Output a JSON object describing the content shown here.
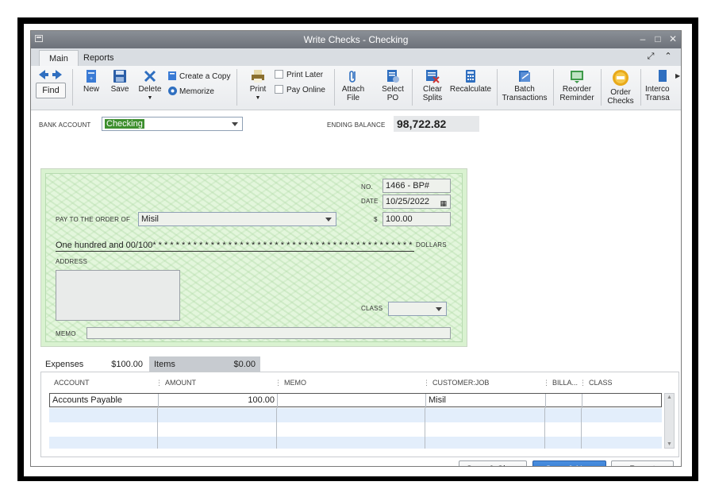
{
  "window": {
    "title": "Write Checks - Checking"
  },
  "tabs": [
    {
      "label": "Main"
    },
    {
      "label": "Reports"
    }
  ],
  "toolbar": {
    "find_label": "Find",
    "new_label": "New",
    "save_label": "Save",
    "delete_label": "Delete",
    "create_copy_label": "Create a Copy",
    "memorize_label": "Memorize",
    "print_label": "Print",
    "print_later_label": "Print Later",
    "pay_online_label": "Pay Online",
    "attach_file_label": [
      "Attach",
      "File"
    ],
    "select_po_label": [
      "Select",
      "PO"
    ],
    "clear_splits_label": [
      "Clear",
      "Splits"
    ],
    "recalculate_label": "Recalculate",
    "batch_transactions_label": [
      "Batch",
      "Transactions"
    ],
    "reorder_reminder_label": [
      "Reorder",
      "Reminder"
    ],
    "order_checks_label": [
      "Order",
      "Checks"
    ],
    "intercompany_label": [
      "Interco",
      "Transa"
    ]
  },
  "bank": {
    "label": "BANK ACCOUNT",
    "value": "Checking",
    "ending_balance_label": "ENDING BALANCE",
    "ending_balance": "98,722.82"
  },
  "check": {
    "no_label": "NO.",
    "no_value": "1466 - BP#",
    "date_label": "DATE",
    "date_value": "10/25/2022",
    "payto_label": "PAY TO THE ORDER OF",
    "payto_value": "Misil",
    "amount_symbol": "$",
    "amount_value": "100.00",
    "amount_words": "One hundred and 00/100* * * * * * * * * * * * * * * * * * * * * * * * * * * * * * * * * * * * * * * * * * * * * * * * * * * *",
    "dollars_label": "DOLLARS",
    "address_label": "ADDRESS",
    "class_label": "CLASS",
    "memo_label": "MEMO"
  },
  "detail_tabs": {
    "expenses_label": "Expenses",
    "expenses_amount": "$100.00",
    "items_label": "Items",
    "items_amount": "$0.00"
  },
  "grid": {
    "columns": [
      "ACCOUNT",
      "AMOUNT",
      "MEMO",
      "CUSTOMER:JOB",
      "BILLA...",
      "CLASS"
    ],
    "rows": [
      {
        "account": "Accounts Payable",
        "amount": "100.00",
        "memo": "",
        "customer": "Misil",
        "billable": "",
        "class": ""
      }
    ]
  },
  "buttons": {
    "save_close": "Save & Close",
    "save_new": "Save & New",
    "revert": "Revert"
  },
  "colors": {
    "accent": "#2a6fc7",
    "check_bg": "#e3f6dc",
    "titlebar": "#7b8088"
  }
}
